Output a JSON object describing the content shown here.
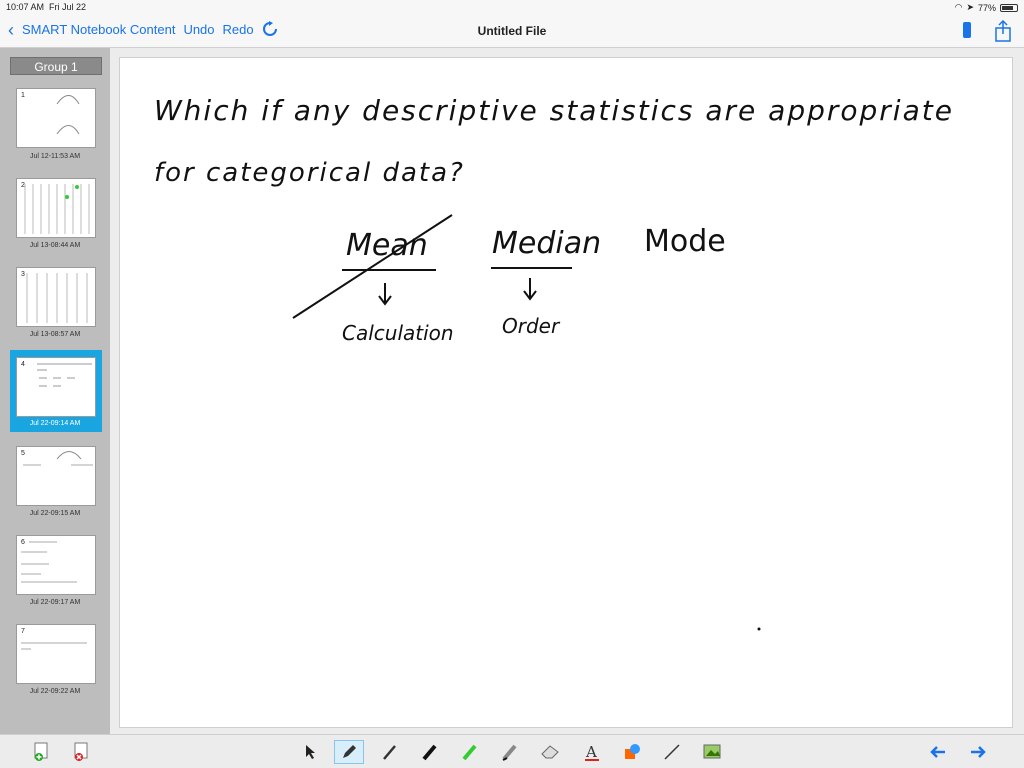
{
  "status": {
    "time": "10:07 AM",
    "date": "Fri Jul 22",
    "battery": "77%"
  },
  "nav": {
    "back_label": "SMART Notebook Content",
    "undo_label": "Undo",
    "redo_label": "Redo",
    "title": "Untitled File"
  },
  "sidebar": {
    "group_label": "Group 1",
    "pages": [
      {
        "num": "1",
        "date": "Jul 12-11:53 AM"
      },
      {
        "num": "2",
        "date": "Jul 13-08:44 AM"
      },
      {
        "num": "3",
        "date": "Jul 13-08:57 AM"
      },
      {
        "num": "4",
        "date": "Jul 22-09:14 AM"
      },
      {
        "num": "5",
        "date": "Jul 22-09:15 AM"
      },
      {
        "num": "6",
        "date": "Jul 22-09:17 AM"
      },
      {
        "num": "7",
        "date": "Jul 22-09:22 AM"
      }
    ],
    "selected_page": "4"
  },
  "canvas": {
    "line1": "Which if any descriptive statistics are appropriate",
    "line2": "for categorical data?",
    "word_mean": "Mean",
    "word_median": "Median",
    "word_mode": "Mode",
    "label_calc": "Calculation",
    "label_order": "Order"
  },
  "toolbar": {
    "icons": [
      "add-page-icon",
      "delete-page-icon",
      "select-arrow-icon",
      "pen-icon",
      "brush-icon",
      "marker-icon",
      "highlighter-icon",
      "calligraphy-pen-icon",
      "eraser-icon",
      "text-icon",
      "shapes-icon",
      "line-icon",
      "image-icon",
      "prev-page-icon",
      "next-page-icon"
    ]
  },
  "colors": {
    "accent": "#1a73e8",
    "selection": "#19a6e0",
    "sidebar": "#bdbdbd"
  }
}
